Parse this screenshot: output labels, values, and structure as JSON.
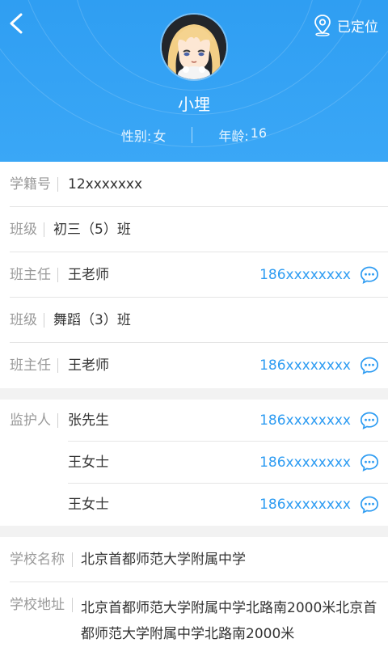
{
  "header": {
    "location_label": "已定位",
    "name": "小埋",
    "gender_label": "性别:",
    "gender": "女",
    "age_label": "年龄:",
    "age": "16"
  },
  "student": {
    "id_label": "学籍号",
    "id_value": "12xxxxxxx",
    "class1_label": "班级",
    "class1_value": "初三（5）班",
    "teacher1_label": "班主任",
    "teacher1_name": "王老师",
    "teacher1_phone": "186xxxxxxxx",
    "class2_label": "班级",
    "class2_value": "舞蹈（3）班",
    "teacher2_label": "班主任",
    "teacher2_name": "王老师",
    "teacher2_phone": "186xxxxxxxx"
  },
  "guardians": {
    "label": "监护人",
    "items": [
      {
        "name": "张先生",
        "phone": "186xxxxxxxx"
      },
      {
        "name": "王女士",
        "phone": "186xxxxxxxx"
      },
      {
        "name": "王女士",
        "phone": "186xxxxxxxx"
      }
    ]
  },
  "school": {
    "name_label": "学校名称",
    "name_value": "北京首都师范大学附属中学",
    "address_label": "学校地址",
    "address_value": "北京首都师范大学附属中学北路南2000米北京首都师范大学附属中学北路南2000米"
  },
  "colors": {
    "header_blue": "#3aa7f6",
    "link_blue": "#2e9cf2"
  },
  "icons": {
    "back": "chevron-left-icon",
    "location": "location-pin-icon",
    "chat": "chat-bubble-icon"
  }
}
